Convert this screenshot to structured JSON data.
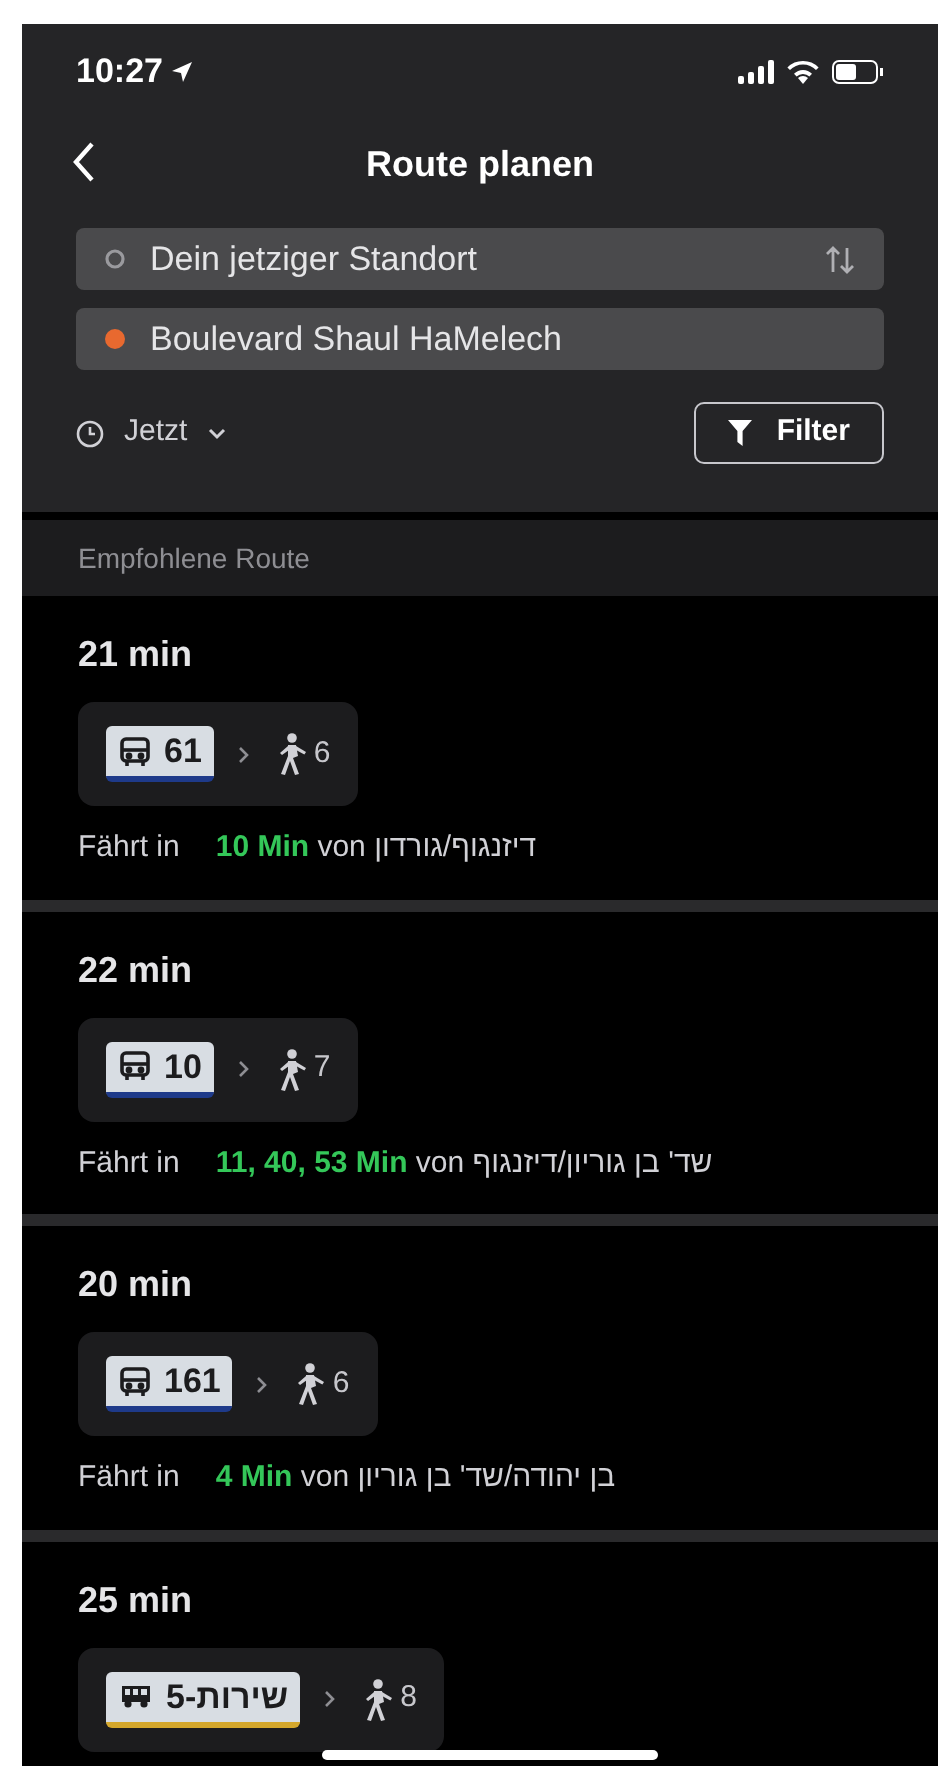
{
  "status_bar": {
    "time": "10:27"
  },
  "header": {
    "title": "Route planen"
  },
  "origin": {
    "value": "Dein jetziger Standort"
  },
  "destination": {
    "value": "Boulevard Shaul HaMelech"
  },
  "time_selector": {
    "label": "Jetzt"
  },
  "filter_button": {
    "label": "Filter"
  },
  "section_title": "Empfohlene Route",
  "routes": [
    {
      "duration": "21 min",
      "line": {
        "kind": "bus",
        "label": "61",
        "color": "#1e3a8a"
      },
      "walk": "6",
      "departure": {
        "prefix": "Fährt in",
        "times": "10 Min",
        "joiner": "von",
        "stop": "דיזנגוף/גורדון"
      }
    },
    {
      "duration": "22 min",
      "line": {
        "kind": "bus",
        "label": "10",
        "color": "#1e3a8a"
      },
      "walk": "7",
      "departure": {
        "prefix": "Fährt in",
        "times": "11, 40, 53 Min",
        "joiner": "von",
        "stop": "שד' בן גוריון/דיזנגוף"
      }
    },
    {
      "duration": "20 min",
      "line": {
        "kind": "bus",
        "label": "161",
        "color": "#1e3a8a"
      },
      "walk": "6",
      "departure": {
        "prefix": "Fährt in",
        "times": "4 Min",
        "joiner": "von",
        "stop": "בן יהודה/שד' בן גוריון"
      }
    },
    {
      "duration": "25 min",
      "line": {
        "kind": "sherut",
        "label": "5-שירות",
        "color": "#d4a72c"
      },
      "walk": "8"
    }
  ]
}
